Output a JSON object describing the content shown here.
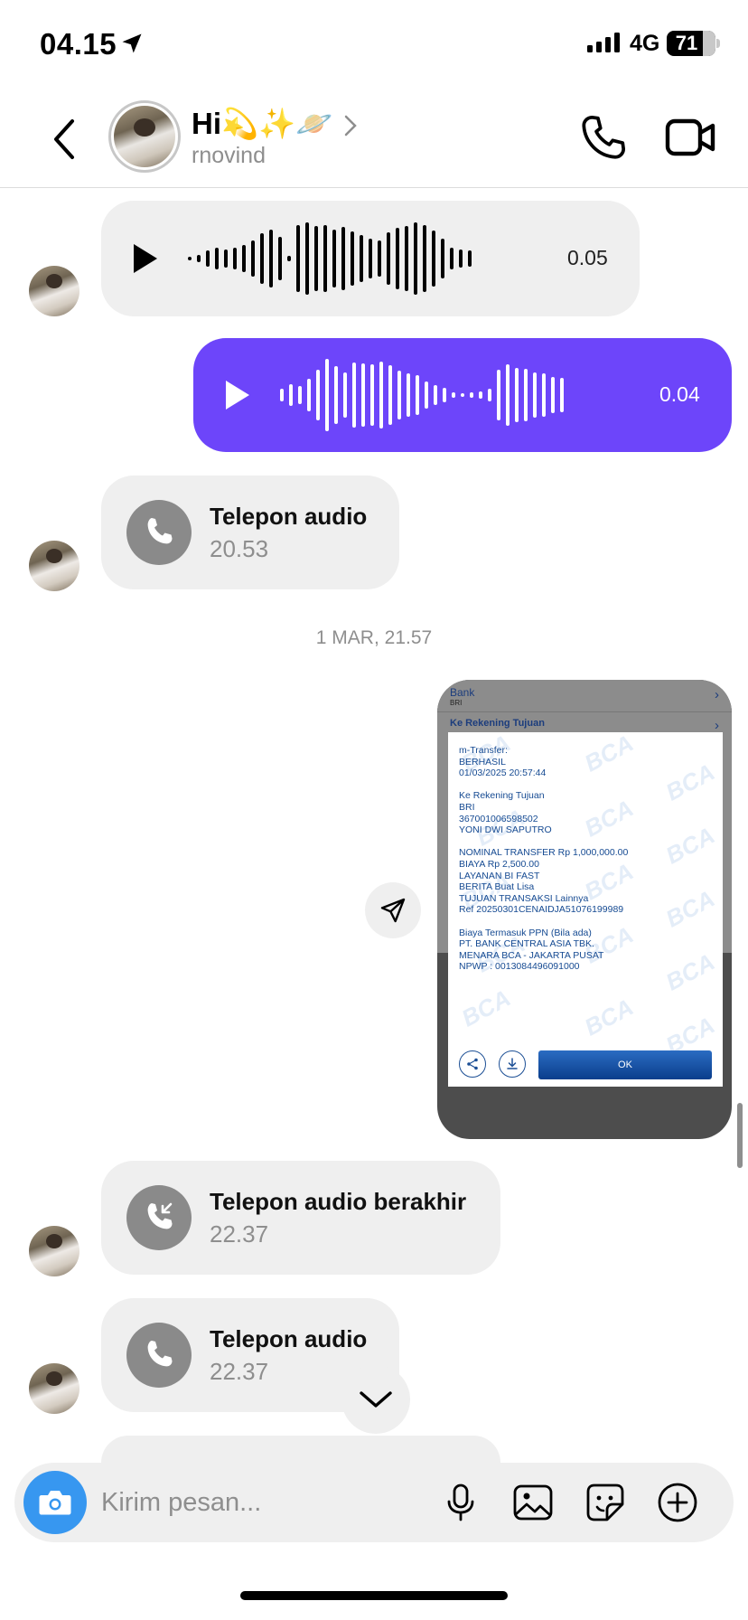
{
  "status_bar": {
    "time": "04.15",
    "network": "4G",
    "battery": "71"
  },
  "header": {
    "title": "Hi💫✨🪐",
    "username": "rnovind"
  },
  "messages": {
    "voice1": {
      "duration": "0.05"
    },
    "voice2": {
      "duration": "0.04"
    },
    "call1": {
      "title": "Telepon audio",
      "time": "20.53"
    },
    "date_separator": "1 MAR, 21.57",
    "receipt": {
      "bank_label": "Bank",
      "bank_value": "BRI",
      "ke_rekening_label": "Ke Rekening Tujuan",
      "body": "m-Transfer:\nBERHASIL\n01/03/2025 20:57:44\n\nKe Rekening Tujuan\nBRI\n367001006598502\nYONI DWI SAPUTRO\n\nNOMINAL TRANSFER Rp 1,000,000.00\nBIAYA Rp 2,500.00\nLAYANAN BI FAST\nBERITA Buat Lisa\nTUJUAN TRANSAKSI Lainnya\nRef 20250301CENAIDJA51076199989\n\nBiaya Termasuk PPN (Bila ada)\nPT. BANK CENTRAL ASIA TBK.\nMENARA BCA - JAKARTA PUSAT\nNPWP : 0013084496091000",
      "ok_label": "OK",
      "watermark": "BCA"
    },
    "call2": {
      "title": "Telepon audio berakhir",
      "time": "22.37"
    },
    "call3": {
      "title": "Telepon audio",
      "time": "22.37"
    }
  },
  "composer": {
    "placeholder": "Kirim pesan..."
  },
  "colors": {
    "accent_purple": "#6d45fa",
    "camera_blue": "#3797f0",
    "bubble_grey": "#efefef"
  }
}
